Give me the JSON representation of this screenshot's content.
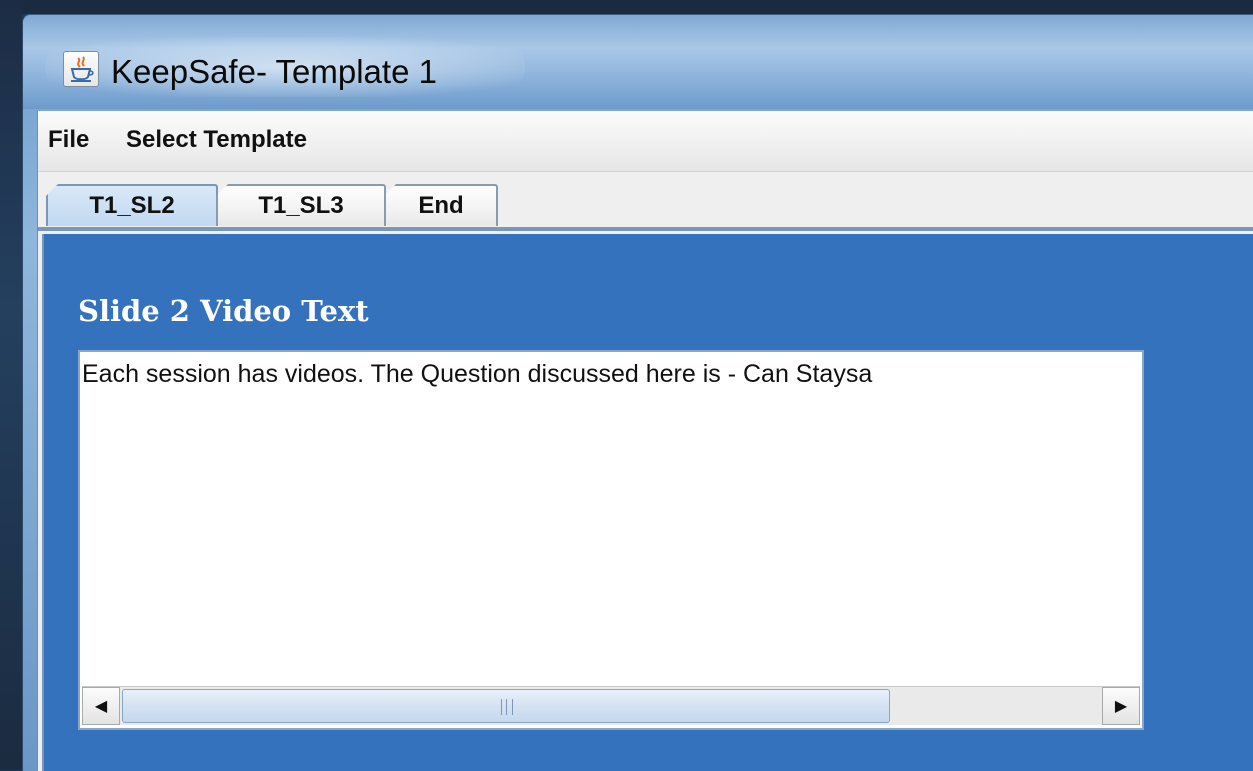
{
  "window": {
    "title": "KeepSafe- Template 1",
    "icon": "java-cup-icon"
  },
  "menubar": {
    "items": [
      {
        "label": "File"
      },
      {
        "label": "Select Template"
      }
    ]
  },
  "tabs": [
    {
      "label": "T1_SL2",
      "selected": true
    },
    {
      "label": "T1_SL3",
      "selected": false
    },
    {
      "label": "End",
      "selected": false
    }
  ],
  "panel": {
    "heading": "Slide 2 Video Text",
    "textarea": {
      "value": "Each session has videos.  The Question discussed here is - Can Staysa"
    },
    "scrollbar": {
      "left_arrow": "◀",
      "right_arrow": "▶"
    }
  },
  "colors": {
    "panel_background": "#3472bd",
    "selected_tab": "#c2d9f1"
  }
}
